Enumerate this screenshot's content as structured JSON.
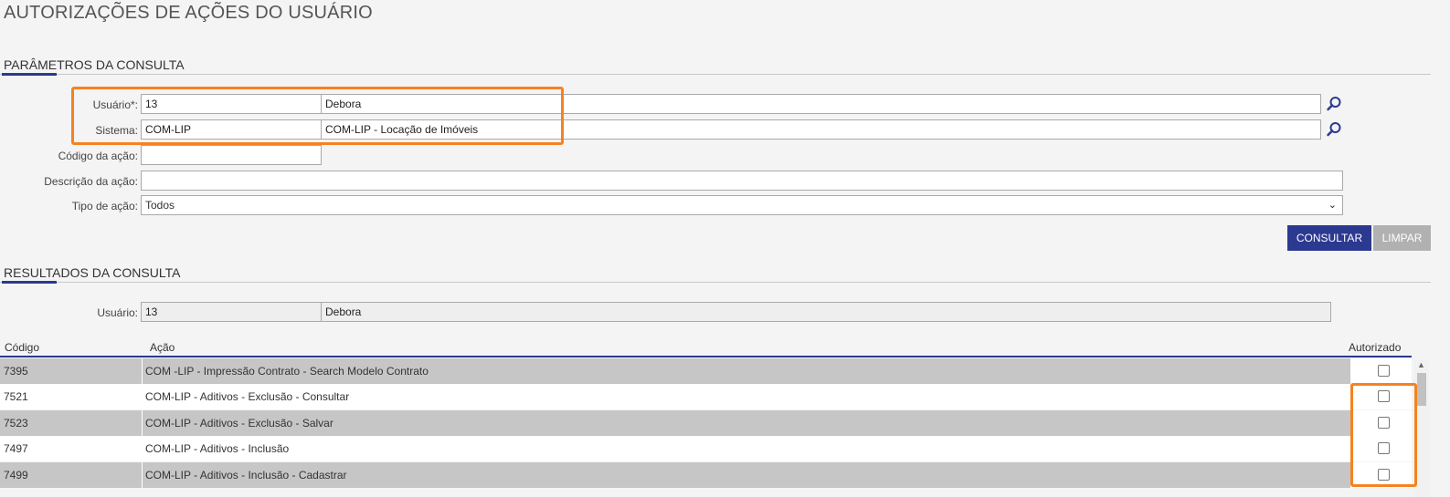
{
  "page": {
    "title": "AUTORIZAÇÕES DE AÇÕES DO USUÁRIO"
  },
  "params_section": {
    "title": "PARÂMETROS DA CONSULTA",
    "usuario_label": "Usuário*:",
    "usuario_code": "13",
    "usuario_name": "Debora",
    "sistema_label": "Sistema:",
    "sistema_code": "COM-LIP",
    "sistema_name": "COM-LIP - Locação de Imóveis",
    "codigo_label": "Código da ação:",
    "codigo_value": "",
    "descricao_label": "Descrição da ação:",
    "descricao_value": "",
    "tipo_label": "Tipo de ação:",
    "tipo_value": "Todos"
  },
  "actions": {
    "consultar": "CONSULTAR",
    "limpar": "LIMPAR"
  },
  "results_section": {
    "title": "RESULTADOS DA CONSULTA",
    "usuario_label": "Usuário:",
    "usuario_code": "13",
    "usuario_name": "Debora"
  },
  "table": {
    "headers": {
      "codigo": "Código",
      "acao": "Ação",
      "autorizado": "Autorizado"
    },
    "rows": [
      {
        "codigo": "7395",
        "acao": "COM -LIP - Impressão Contrato - Search Modelo Contrato",
        "autorizado": false
      },
      {
        "codigo": "7521",
        "acao": "COM-LIP - Aditivos - Exclusão - Consultar",
        "autorizado": false
      },
      {
        "codigo": "7523",
        "acao": "COM-LIP - Aditivos - Exclusão - Salvar",
        "autorizado": false
      },
      {
        "codigo": "7497",
        "acao": "COM-LIP - Aditivos - Inclusão",
        "autorizado": false
      },
      {
        "codigo": "7499",
        "acao": "COM-LIP - Aditivos - Inclusão - Cadastrar",
        "autorizado": false
      }
    ]
  },
  "colors": {
    "accent": "#2b3990",
    "highlight": "#f58220",
    "row_odd": "#c6c6c6",
    "disabled": "#b1b1b1"
  },
  "icons": {
    "search": "magnifier-icon",
    "dropdown": "chevron-down-icon",
    "scroll_up": "arrow-up-icon"
  }
}
